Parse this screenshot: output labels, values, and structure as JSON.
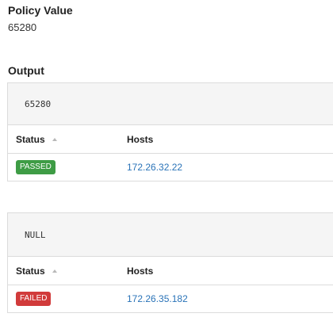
{
  "policy": {
    "title": "Policy Value",
    "value": "65280"
  },
  "output": {
    "title": "Output",
    "cards": [
      {
        "code": "65280",
        "columns": {
          "status": "Status",
          "hosts": "Hosts"
        },
        "row": {
          "status": "PASSED",
          "status_color": "#3e9c45",
          "host": "172.26.32.22"
        }
      },
      {
        "code": "NULL",
        "columns": {
          "status": "Status",
          "hosts": "Hosts"
        },
        "row": {
          "status": "FAILED",
          "status_color": "#d13b3b",
          "host": "172.26.35.182"
        }
      }
    ]
  },
  "colors": {
    "link": "#2a73b8",
    "passed": "#3e9c45",
    "failed": "#d13b3b",
    "code_bg": "#f5f5f5",
    "border": "#dcdcdc"
  },
  "icons": {
    "sort": "sort-up-icon"
  }
}
